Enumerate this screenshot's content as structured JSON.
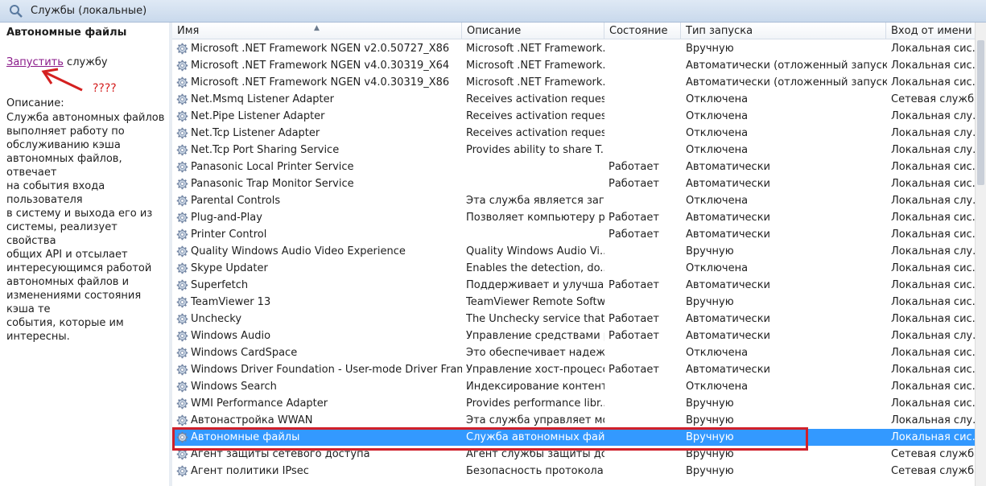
{
  "window": {
    "title": "Службы (локальные)"
  },
  "left_pane": {
    "selected_service": "Автономные файлы",
    "start_link": "Запустить",
    "start_suffix": "службу",
    "annotation": "????",
    "description_label": "Описание:",
    "description_lines": [
      "Служба автономных файлов",
      "выполняет работу по",
      "обслуживанию кэша",
      "автономных файлов, отвечает",
      "на события входа пользователя",
      "в систему и выхода его из",
      "системы, реализует свойства",
      "общих API и отсылает",
      "интересующимся работой",
      "автономных файлов и",
      "изменениями состояния кэша те",
      "события, которые им интересны."
    ]
  },
  "table": {
    "columns": [
      "Имя",
      "Описание",
      "Состояние",
      "Тип запуска",
      "Вход от имени"
    ],
    "rows": [
      {
        "name": "Microsoft .NET Framework NGEN v2.0.50727_X86",
        "desc": "Microsoft .NET Framework...",
        "state": "",
        "type": "Вручную",
        "logon": "Локальная сис..."
      },
      {
        "name": "Microsoft .NET Framework NGEN v4.0.30319_X64",
        "desc": "Microsoft .NET Framework...",
        "state": "",
        "type": "Автоматически (отложенный запуск)",
        "logon": "Локальная сис..."
      },
      {
        "name": "Microsoft .NET Framework NGEN v4.0.30319_X86",
        "desc": "Microsoft .NET Framework...",
        "state": "",
        "type": "Автоматически (отложенный запуск)",
        "logon": "Локальная сис..."
      },
      {
        "name": "Net.Msmq Listener Adapter",
        "desc": "Receives activation reques...",
        "state": "",
        "type": "Отключена",
        "logon": "Сетевая служба"
      },
      {
        "name": "Net.Pipe Listener Adapter",
        "desc": "Receives activation reques...",
        "state": "",
        "type": "Отключена",
        "logon": "Локальная слу..."
      },
      {
        "name": "Net.Tcp Listener Adapter",
        "desc": "Receives activation reques...",
        "state": "",
        "type": "Отключена",
        "logon": "Локальная слу..."
      },
      {
        "name": "Net.Tcp Port Sharing Service",
        "desc": "Provides ability to share T...",
        "state": "",
        "type": "Отключена",
        "logon": "Локальная слу..."
      },
      {
        "name": "Panasonic Local Printer Service",
        "desc": "",
        "state": "Работает",
        "type": "Автоматически",
        "logon": "Локальная сис..."
      },
      {
        "name": "Panasonic Trap Monitor Service",
        "desc": "",
        "state": "Работает",
        "type": "Автоматически",
        "logon": "Локальная сис..."
      },
      {
        "name": "Parental Controls",
        "desc": "Эта служба является загл...",
        "state": "",
        "type": "Отключена",
        "logon": "Локальная слу..."
      },
      {
        "name": "Plug-and-Play",
        "desc": "Позволяет компьютеру р...",
        "state": "Работает",
        "type": "Автоматически",
        "logon": "Локальная сис..."
      },
      {
        "name": "Printer Control",
        "desc": "",
        "state": "Работает",
        "type": "Автоматически",
        "logon": "Локальная сис..."
      },
      {
        "name": "Quality Windows Audio Video Experience",
        "desc": "Quality Windows Audio Vi...",
        "state": "",
        "type": "Вручную",
        "logon": "Локальная слу..."
      },
      {
        "name": "Skype Updater",
        "desc": "Enables the detection, do...",
        "state": "",
        "type": "Отключена",
        "logon": "Локальная сис..."
      },
      {
        "name": "Superfetch",
        "desc": "Поддерживает и улучшае...",
        "state": "Работает",
        "type": "Автоматически",
        "logon": "Локальная сис..."
      },
      {
        "name": "TeamViewer 13",
        "desc": "TeamViewer Remote Softw...",
        "state": "",
        "type": "Вручную",
        "logon": "Локальная сис..."
      },
      {
        "name": "Unchecky",
        "desc": "The Unchecky service that ...",
        "state": "Работает",
        "type": "Автоматически",
        "logon": "Локальная сис..."
      },
      {
        "name": "Windows Audio",
        "desc": "Управление средствами р...",
        "state": "Работает",
        "type": "Автоматически",
        "logon": "Локальная слу..."
      },
      {
        "name": "Windows CardSpace",
        "desc": "Это обеспечивает надежн...",
        "state": "",
        "type": "Отключена",
        "logon": "Локальная сис..."
      },
      {
        "name": "Windows Driver Foundation - User-mode Driver Frame...",
        "desc": "Управление хост-процесс...",
        "state": "Работает",
        "type": "Автоматически",
        "logon": "Локальная сис..."
      },
      {
        "name": "Windows Search",
        "desc": "Индексирование контент...",
        "state": "",
        "type": "Отключена",
        "logon": "Локальная сис..."
      },
      {
        "name": "WMI Performance Adapter",
        "desc": "Provides performance libr...",
        "state": "",
        "type": "Вручную",
        "logon": "Локальная сис..."
      },
      {
        "name": "Автонастройка WWAN",
        "desc": "Эта служба управляет мо...",
        "state": "",
        "type": "Вручную",
        "logon": "Локальная слу..."
      },
      {
        "name": "Автономные файлы",
        "desc": "Служба автономных файл...",
        "state": "",
        "type": "Вручную",
        "logon": "Локальная сис...",
        "selected": true
      },
      {
        "name": "Агент защиты сетевого доступа",
        "desc": "Агент службы защиты дос...",
        "state": "",
        "type": "Вручную",
        "logon": "Сетевая служба"
      },
      {
        "name": "Агент политики IPsec",
        "desc": "Безопасность протокола I...",
        "state": "",
        "type": "Вручную",
        "logon": "Сетевая служба"
      }
    ]
  },
  "colors": {
    "selection": "#3399ff",
    "highlight_box": "#d0202a",
    "annotation": "#d42020"
  }
}
